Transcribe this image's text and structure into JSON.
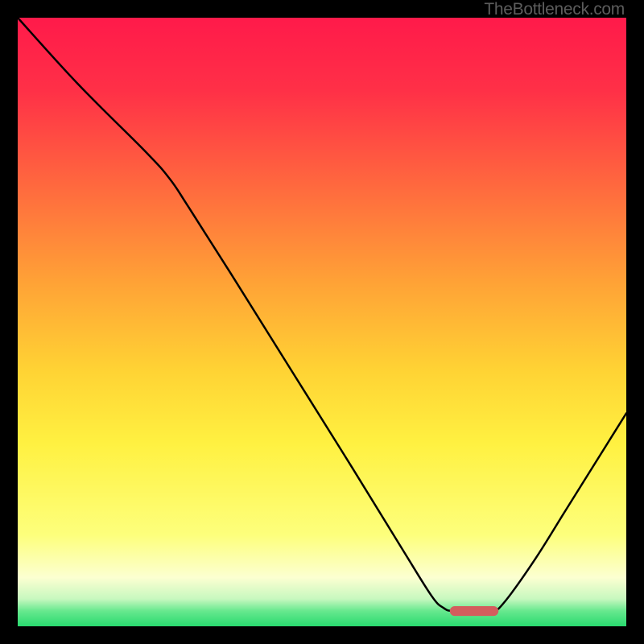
{
  "watermark": "TheBottleneck.com",
  "chart_data": {
    "type": "line",
    "title": "",
    "xlabel": "",
    "ylabel": "",
    "xlim": [
      0,
      100
    ],
    "ylim": [
      0,
      100
    ],
    "axes_visible": false,
    "grid": false,
    "legend": false,
    "gradient_background": {
      "stops": [
        {
          "offset": 0.0,
          "color": "#ff1a4a"
        },
        {
          "offset": 0.12,
          "color": "#ff3047"
        },
        {
          "offset": 0.28,
          "color": "#ff6a3e"
        },
        {
          "offset": 0.44,
          "color": "#ffa436"
        },
        {
          "offset": 0.58,
          "color": "#ffd334"
        },
        {
          "offset": 0.7,
          "color": "#fff141"
        },
        {
          "offset": 0.85,
          "color": "#fdff7c"
        },
        {
          "offset": 0.92,
          "color": "#fcffd1"
        },
        {
          "offset": 0.955,
          "color": "#c7f8bf"
        },
        {
          "offset": 0.975,
          "color": "#66e88e"
        },
        {
          "offset": 1.0,
          "color": "#29da6f"
        }
      ]
    },
    "curve": {
      "description": "Bottleneck-style V curve: steep drop from top-left to a flat valley near x≈74, then rises to right edge.",
      "stroke": "#000000",
      "stroke_width": 2.5,
      "points_xy": [
        [
          0,
          100
        ],
        [
          10,
          89
        ],
        [
          21,
          78
        ],
        [
          25,
          73.5
        ],
        [
          28,
          69
        ],
        [
          35,
          58
        ],
        [
          45,
          42
        ],
        [
          55,
          26
        ],
        [
          63,
          13
        ],
        [
          68,
          5
        ],
        [
          70,
          3
        ],
        [
          71.5,
          2.5
        ],
        [
          75,
          2.5
        ],
        [
          78,
          2.5
        ],
        [
          80,
          4
        ],
        [
          85,
          11
        ],
        [
          90,
          19
        ],
        [
          95,
          27
        ],
        [
          100,
          35
        ]
      ]
    },
    "marker": {
      "description": "Optimal-zone pill marker at valley bottom",
      "color": "#d35d5d",
      "x_center": 75,
      "y_center": 2.5,
      "width": 8,
      "height": 1.6
    }
  }
}
